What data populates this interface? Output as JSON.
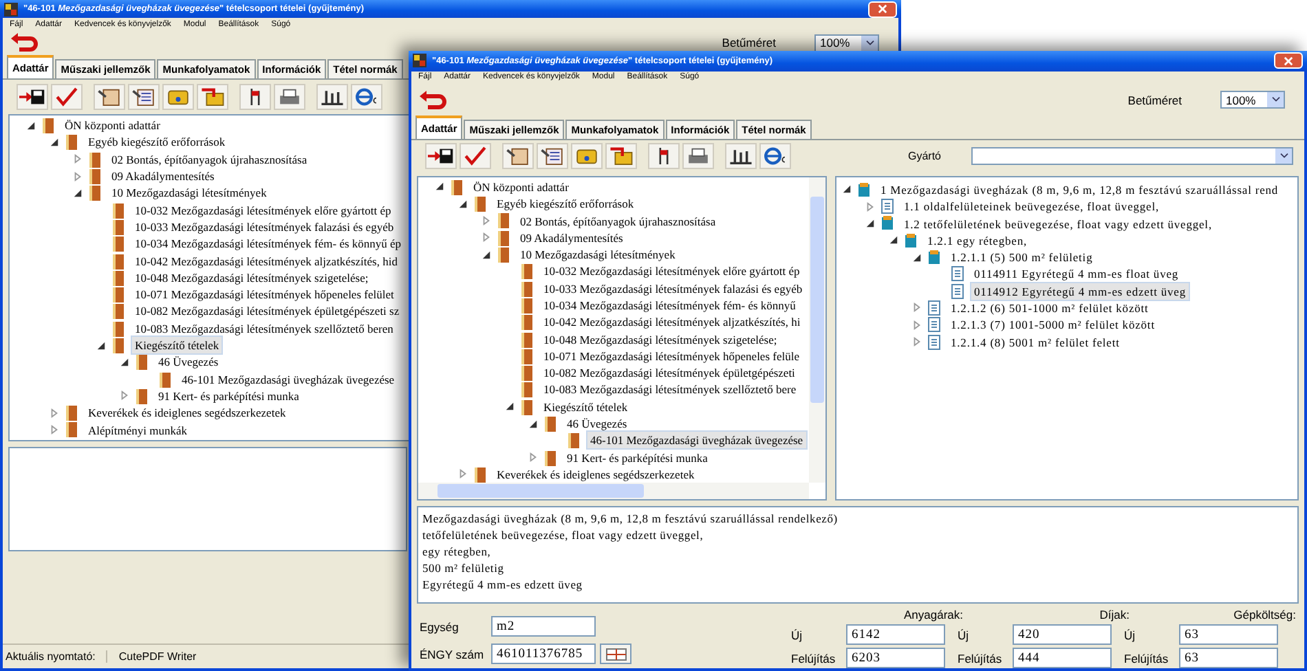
{
  "back_window": {
    "title": "\"46-101 *Mezőgazdasági üvegházak üvegezése*\" tételcsoport tételei (gyűjtemény)",
    "menu": [
      "Fájl",
      "Adattár",
      "Kedvencek és könyvjelzők",
      "Modul",
      "Beállítások",
      "Súgó"
    ],
    "font_size": {
      "label": "Betűméret",
      "value": "100%"
    },
    "tabs": [
      {
        "label": "Adattár",
        "selected": true
      },
      {
        "label": "Műszaki jellemzők",
        "selected": false
      },
      {
        "label": "Munkafolyamatok",
        "selected": false
      },
      {
        "label": "Információk",
        "selected": false
      },
      {
        "label": "Tétel normák",
        "selected": false
      }
    ],
    "tree": [
      {
        "label": "ÖN központi adattár",
        "expanded": true,
        "selected": false,
        "children": [
          {
            "label": "Egyéb kiegészítő erőforrások",
            "expanded": true,
            "selected": false,
            "children": [
              {
                "label": "02 Bontás, építőanyagok újrahasznosítása",
                "expanded": false,
                "selected": false
              },
              {
                "label": "09 Akadálymentesítés",
                "expanded": false,
                "selected": false
              },
              {
                "label": "10 Mezőgazdasági létesítmények",
                "expanded": true,
                "selected": false,
                "children": [
                  {
                    "label": "10-032 Mezőgazdasági létesítmények előre gyártott ép",
                    "selected": false
                  },
                  {
                    "label": "10-033 Mezőgazdasági létesítmények falazási és egyéb",
                    "selected": false
                  },
                  {
                    "label": "10-034 Mezőgazdasági létesítmények fém- és könnyű ép",
                    "selected": false
                  },
                  {
                    "label": "10-042 Mezőgazdasági létesítmények aljzatkészítés, hid",
                    "selected": false
                  },
                  {
                    "label": "10-048 Mezőgazdasági létesítmények szigetelése;",
                    "selected": false
                  },
                  {
                    "label": "10-071 Mezőgazdasági létesítmények hőpeneles felület",
                    "selected": false
                  },
                  {
                    "label": "10-082 Mezőgazdasági létesítmények épületgépészeti sz",
                    "selected": false
                  },
                  {
                    "label": "10-083 Mezőgazdasági létesítmények szellőztető beren",
                    "selected": false
                  },
                  {
                    "label": "Kiegészítő tételek",
                    "expanded": true,
                    "selected": true,
                    "children": [
                      {
                        "label": "46 Üvegezés",
                        "expanded": true,
                        "selected": false,
                        "children": [
                          {
                            "label": "46-101 Mezőgazdasági üvegházak üvegezése",
                            "selected": false
                          }
                        ]
                      },
                      {
                        "label": "91 Kert- és parképítési munka",
                        "expanded": false,
                        "selected": false
                      }
                    ]
                  }
                ]
              }
            ]
          },
          {
            "label": "Keverékek és ideiglenes segédszerkezetek",
            "expanded": false,
            "selected": false
          },
          {
            "label": "Alépítményi munkák",
            "expanded": false,
            "selected": false
          }
        ]
      }
    ],
    "status_bar": {
      "label": "Aktuális nyomtató:",
      "value": "CutePDF Writer"
    }
  },
  "front_window": {
    "title": "\"46-101 *Mezőgazdasági üvegházak üvegezése*\" tételcsoport tételei (gyűjtemény)",
    "menu": [
      "Fájl",
      "Adattár",
      "Kedvencek és könyvjelzők",
      "Modul",
      "Beállítások",
      "Súgó"
    ],
    "font_size": {
      "label": "Betűméret",
      "value": "100%"
    },
    "tabs": [
      {
        "label": "Adattár",
        "selected": true
      },
      {
        "label": "Műszaki jellemzők",
        "selected": false
      },
      {
        "label": "Munkafolyamatok",
        "selected": false
      },
      {
        "label": "Információk",
        "selected": false
      },
      {
        "label": "Tétel normák",
        "selected": false
      }
    ],
    "manufacturer": {
      "label": "Gyártó"
    },
    "tree": [
      {
        "label": "ÖN központi adattár",
        "expanded": true,
        "selected": false,
        "children": [
          {
            "label": "Egyéb kiegészítő erőforrások",
            "expanded": true,
            "selected": false,
            "children": [
              {
                "label": "02 Bontás, építőanyagok újrahasznosítása",
                "expanded": false,
                "selected": false
              },
              {
                "label": "09 Akadálymentesítés",
                "expanded": false,
                "selected": false
              },
              {
                "label": "10 Mezőgazdasági létesítmények",
                "expanded": true,
                "selected": false,
                "children": [
                  {
                    "label": "10-032 Mezőgazdasági létesítmények előre gyártott ép",
                    "selected": false
                  },
                  {
                    "label": "10-033 Mezőgazdasági létesítmények falazási és egyéb",
                    "selected": false
                  },
                  {
                    "label": "10-034 Mezőgazdasági létesítmények fém- és könnyű",
                    "selected": false
                  },
                  {
                    "label": "10-042 Mezőgazdasági létesítmények aljzatkészítés, hi",
                    "selected": false
                  },
                  {
                    "label": "10-048 Mezőgazdasági létesítmények szigetelése;",
                    "selected": false
                  },
                  {
                    "label": "10-071 Mezőgazdasági létesítmények hőpeneles felüle",
                    "selected": false
                  },
                  {
                    "label": "10-082 Mezőgazdasági létesítmények épületgépészeti",
                    "selected": false
                  },
                  {
                    "label": "10-083 Mezőgazdasági létesítmények szellőztető bere",
                    "selected": false
                  },
                  {
                    "label": "Kiegészítő tételek",
                    "expanded": true,
                    "selected": false,
                    "children": [
                      {
                        "label": "46 Üvegezés",
                        "expanded": true,
                        "selected": false,
                        "children": [
                          {
                            "label": "46-101 Mezőgazdasági üvegházak üvegezése",
                            "selected": true
                          }
                        ]
                      },
                      {
                        "label": "91 Kert- és parképítési munka",
                        "expanded": false,
                        "selected": false
                      }
                    ]
                  }
                ]
              }
            ]
          },
          {
            "label": "Keverékek és ideiglenes segédszerkezetek",
            "expanded": false,
            "selected": false
          }
        ]
      }
    ],
    "item_tree": [
      {
        "label": "1 Mezőgazdasági üvegházak (8 m, 9,6 m, 12,8 m fesztávú szaruállással rend",
        "expanded": true,
        "selected": false,
        "children": [
          {
            "label": "1.1 oldalfelületeinek beüvegezése, float üveggel,",
            "expanded": false,
            "selected": false
          },
          {
            "label": "1.2 tetőfelületének beüvegezése, float vagy edzett üveggel,",
            "expanded": true,
            "selected": false,
            "children": [
              {
                "label": "1.2.1 egy rétegben,",
                "expanded": true,
                "selected": false,
                "children": [
                  {
                    "label": "1.2.1.1 (5) 500 m² felületig",
                    "expanded": true,
                    "selected": false,
                    "children": [
                      {
                        "label": "0114911 Egyrétegű 4 mm-es float üveg",
                        "selected": false
                      },
                      {
                        "label": "0114912 Egyrétegű 4 mm-es edzett üveg",
                        "selected": true
                      }
                    ]
                  },
                  {
                    "label": "1.2.1.2 (6) 501-1000 m² felület között",
                    "expanded": false,
                    "selected": false
                  },
                  {
                    "label": "1.2.1.3 (7) 1001-5000 m² felület között",
                    "expanded": false,
                    "selected": false
                  },
                  {
                    "label": "1.2.1.4 (8) 5001 m² felület felett",
                    "expanded": false,
                    "selected": false
                  }
                ]
              }
            ]
          }
        ]
      }
    ],
    "description": [
      "Mezőgazdasági üvegházak (8 m, 9,6 m, 12,8 m fesztávú szaruállással rendelkező)",
      "tetőfelületének beüvegezése, float vagy edzett üveggel,",
      "egy rétegben,",
      "500 m² felületig",
      "Egyrétegű 4 mm-es edzett üveg"
    ],
    "unit": {
      "label": "Egység",
      "value": "m2"
    },
    "engy": {
      "label": "ÉNGY szám",
      "value": "461011376785"
    },
    "prices": [
      {
        "heading": "Anyagárak:",
        "new_label": "Új",
        "new_value": "6142",
        "renovation_label": "Felújítás",
        "renovation_value": "6203"
      },
      {
        "heading": "Díjak:",
        "new_label": "Új",
        "new_value": "420",
        "renovation_label": "Felújítás",
        "renovation_value": "444"
      },
      {
        "heading": "Gépköltség:",
        "new_label": "Új",
        "new_value": "63",
        "renovation_label": "Felújítás",
        "renovation_value": "63"
      }
    ]
  }
}
